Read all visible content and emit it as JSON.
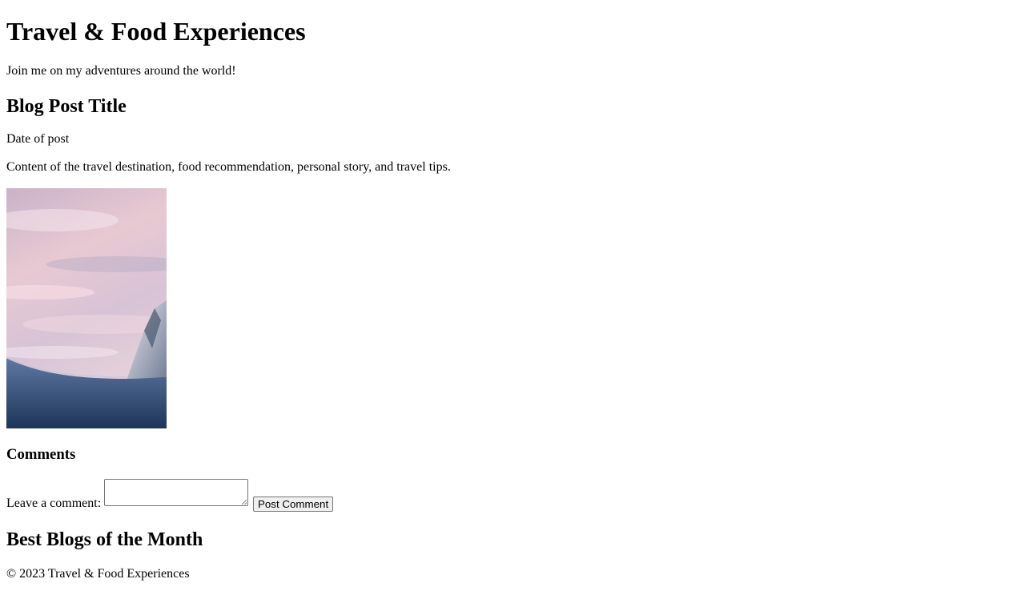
{
  "header": {
    "title": "Travel & Food Experiences",
    "tagline": "Join me on my adventures around the world!"
  },
  "post": {
    "title": "Blog Post Title",
    "date": "Date of post",
    "content": "Content of the travel destination, food recommendation, personal story, and travel tips.",
    "image_icon": "mountain-photo"
  },
  "comments": {
    "title": "Comments",
    "label": "Leave a comment:",
    "textarea_value": "",
    "button_label": "Post Comment"
  },
  "best_blogs": {
    "title": "Best Blogs of the Month"
  },
  "footer": {
    "text": "© 2023 Travel & Food Experiences"
  }
}
